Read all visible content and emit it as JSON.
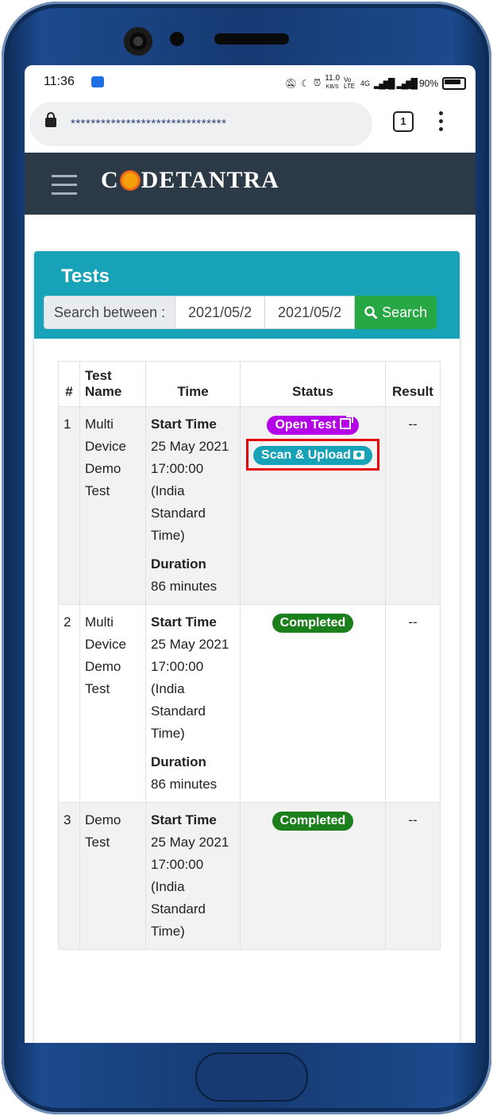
{
  "statusbar": {
    "time": "11:36",
    "network_speed": "11.0",
    "network_unit": "KB/S",
    "volte": "Vo LTE",
    "network_type": "4G",
    "battery": "90%"
  },
  "browser": {
    "url": "*******************************",
    "tab_count": "1"
  },
  "navbar": {
    "brand_prefix": "C",
    "brand_suffix": "DETANTRA"
  },
  "tests": {
    "title": "Tests",
    "search_label": "Search between :",
    "date_from": "2021/05/2",
    "date_to": "2021/05/2",
    "search_button": "Search",
    "columns": [
      "#",
      "Test Name",
      "Time",
      "Status",
      "Result"
    ],
    "rows": [
      {
        "num": "1",
        "name": "Multi Device Demo Test",
        "start_label": "Start Time",
        "start": "25 May 2021 17:00:00 (India Standard Time)",
        "duration_label": "Duration",
        "duration": "86 minutes",
        "status_primary": "Open Test",
        "status_secondary": "Scan & Upload",
        "result": "--"
      },
      {
        "num": "2",
        "name": "Multi Device Demo Test",
        "start_label": "Start Time",
        "start": "25 May 2021 17:00:00 (India Standard Time)",
        "duration_label": "Duration",
        "duration": "86 minutes",
        "status_primary": "Completed",
        "result": "--"
      },
      {
        "num": "3",
        "name": "Demo Test",
        "start_label": "Start Time",
        "start": "25 May 2021 17:00:00 (India Standard Time)",
        "status_primary": "Completed",
        "result": "--"
      }
    ]
  },
  "colors": {
    "header": "#17a2b8",
    "navbar": "#2c3a47",
    "search_button": "#28a745",
    "open_badge": "#b300e6",
    "completed_badge": "#1b7f1b",
    "highlight": "#e60000"
  }
}
